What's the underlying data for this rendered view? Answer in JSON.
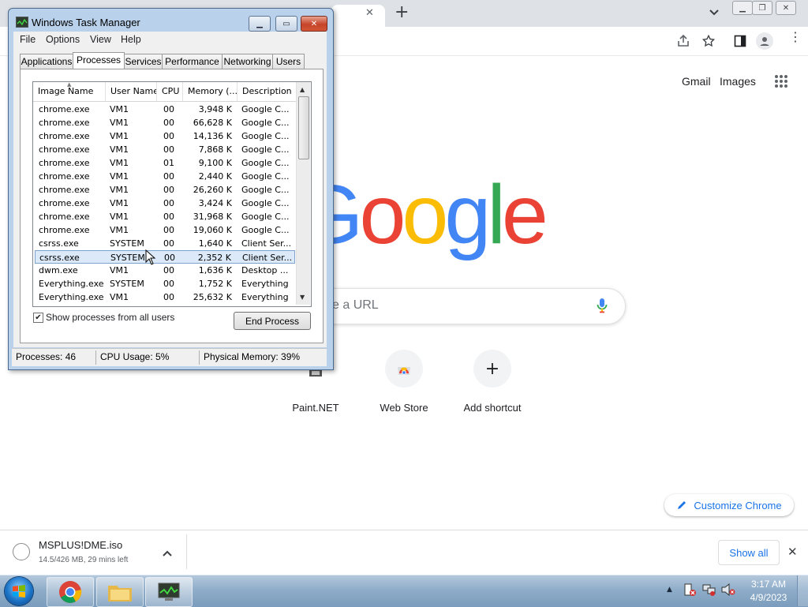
{
  "chrome": {
    "tab_close_glyph": "✕",
    "new_tab_glyph": "+",
    "header_links": {
      "gmail": "Gmail",
      "images": "Images"
    },
    "google_letters": [
      {
        "char": "G",
        "color": "#4285f4"
      },
      {
        "char": "o",
        "color": "#ea4335"
      },
      {
        "char": "o",
        "color": "#fbbc05"
      },
      {
        "char": "g",
        "color": "#4285f4"
      },
      {
        "char": "l",
        "color": "#34a853"
      },
      {
        "char": "e",
        "color": "#ea4335"
      }
    ],
    "search_placeholder_visible": "e a URL",
    "shortcuts": [
      {
        "label": "Paint.NET",
        "icon": "paint-net-icon"
      },
      {
        "label": "Web Store",
        "icon": "web-store-icon"
      },
      {
        "label": "Add shortcut",
        "icon": "plus-icon"
      }
    ],
    "customize_label": "Customize Chrome",
    "download": {
      "filename": "MSPLUS!DME.iso",
      "progress": "14.5/426 MB, 29 mins left",
      "show_all": "Show all"
    }
  },
  "task_manager": {
    "title": "Windows Task Manager",
    "menu": [
      "File",
      "Options",
      "View",
      "Help"
    ],
    "tabs": [
      "Applications",
      "Processes",
      "Services",
      "Performance",
      "Networking",
      "Users"
    ],
    "active_tab": "Processes",
    "columns": [
      "Image Name",
      "User Name",
      "CPU",
      "Memory (...",
      "Description"
    ],
    "rows": [
      [
        "chrome.exe",
        "VM1",
        "00",
        "3,948 K",
        "Google C..."
      ],
      [
        "chrome.exe",
        "VM1",
        "00",
        "66,628 K",
        "Google C..."
      ],
      [
        "chrome.exe",
        "VM1",
        "00",
        "14,136 K",
        "Google C..."
      ],
      [
        "chrome.exe",
        "VM1",
        "00",
        "7,868 K",
        "Google C..."
      ],
      [
        "chrome.exe",
        "VM1",
        "01",
        "9,100 K",
        "Google C..."
      ],
      [
        "chrome.exe",
        "VM1",
        "00",
        "2,440 K",
        "Google C..."
      ],
      [
        "chrome.exe",
        "VM1",
        "00",
        "26,260 K",
        "Google C..."
      ],
      [
        "chrome.exe",
        "VM1",
        "00",
        "3,424 K",
        "Google C..."
      ],
      [
        "chrome.exe",
        "VM1",
        "00",
        "31,968 K",
        "Google C..."
      ],
      [
        "chrome.exe",
        "VM1",
        "00",
        "19,060 K",
        "Google C..."
      ],
      [
        "csrss.exe",
        "SYSTEM",
        "00",
        "1,640 K",
        "Client Ser..."
      ],
      [
        "csrss.exe",
        "SYSTEM",
        "00",
        "2,352 K",
        "Client Ser..."
      ],
      [
        "dwm.exe",
        "VM1",
        "00",
        "1,636 K",
        "Desktop ..."
      ],
      [
        "Everything.exe",
        "SYSTEM",
        "00",
        "1,752 K",
        "Everything"
      ],
      [
        "Everything.exe",
        "VM1",
        "00",
        "25,632 K",
        "Everything"
      ]
    ],
    "selected_row": 11,
    "show_all_users_label": "Show processes from all users",
    "show_all_users_checked": true,
    "end_process_label": "End Process",
    "status": {
      "processes": "Processes: 46",
      "cpu": "CPU Usage: 5%",
      "memory": "Physical Memory: 39%"
    }
  },
  "taskbar": {
    "clock_time": "3:17 AM",
    "clock_date": "4/9/2023",
    "buttons": [
      "start-orb-icon",
      "chrome-icon",
      "explorer-icon",
      "task-manager-icon"
    ]
  }
}
